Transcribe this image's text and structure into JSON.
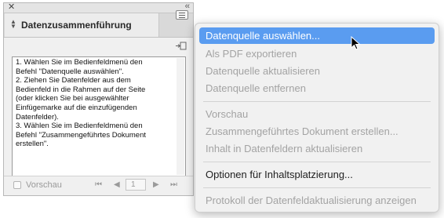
{
  "panel": {
    "title": "Datenzusammenführung",
    "instructions": "1. Wählen Sie im Bedienfeldmenü den\nBefehl \"Datenquelle auswählen\".\n2. Ziehen Sie Datenfelder aus dem\nBedienfeld in die Rahmen auf der Seite\n(oder klicken Sie bei ausgewählter\nEinfügemarke auf die einzufügenden\nDatenfelder).\n3. Wählen Sie im Bedienfeldmenü den\nBefehl \"Zusammengeführtes Dokument\nerstellen\".",
    "preview_label": "Vorschau",
    "page_number": "1"
  },
  "menu": {
    "items": [
      {
        "label": "Datenquelle auswählen...",
        "state": "highlighted"
      },
      {
        "label": "Als PDF exportieren",
        "state": "disabled"
      },
      {
        "label": "Datenquelle aktualisieren",
        "state": "disabled"
      },
      {
        "label": "Datenquelle entfernen",
        "state": "disabled"
      },
      {
        "label": "Vorschau",
        "state": "disabled"
      },
      {
        "label": "Zusammengeführtes Dokument erstellen...",
        "state": "disabled"
      },
      {
        "label": "Inhalt in Datenfeldern aktualisieren",
        "state": "disabled"
      },
      {
        "label": "Optionen für Inhaltsplatzierung...",
        "state": "enabled"
      },
      {
        "label": "Protokoll der Datenfeldaktualisierung anzeigen",
        "state": "disabled"
      }
    ]
  },
  "colors": {
    "highlight": "#5a9cf0",
    "disabled_text": "#a3a3a3"
  }
}
